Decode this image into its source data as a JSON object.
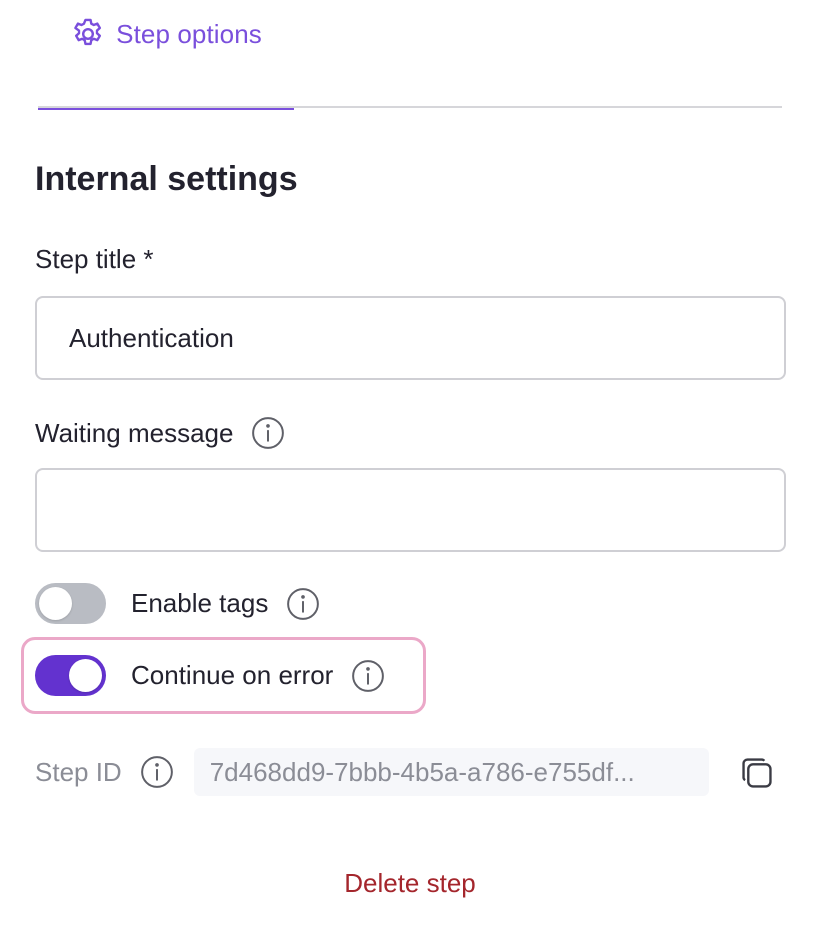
{
  "tabs": {
    "active": {
      "label": "Step options",
      "icon": "gear-icon"
    }
  },
  "section": {
    "title": "Internal settings"
  },
  "step_title": {
    "label": "Step title *",
    "value": "Authentication"
  },
  "waiting_message": {
    "label": "Waiting message",
    "value": "",
    "info_icon": "info-icon"
  },
  "enable_tags": {
    "label": "Enable tags",
    "checked": false
  },
  "continue_on_error": {
    "label": "Continue on error",
    "checked": true
  },
  "step_id": {
    "label": "Step ID",
    "value": "7d468dd9-7bbb-4b5a-a786-e755df...",
    "copy_icon": "copy-icon"
  },
  "actions": {
    "delete_label": "Delete step"
  },
  "colors": {
    "accent": "#7a4fdc",
    "toggle_on": "#6332cf",
    "toggle_off": "#b9bcc3",
    "danger": "#a4262c",
    "highlight": "#eba8c8"
  }
}
